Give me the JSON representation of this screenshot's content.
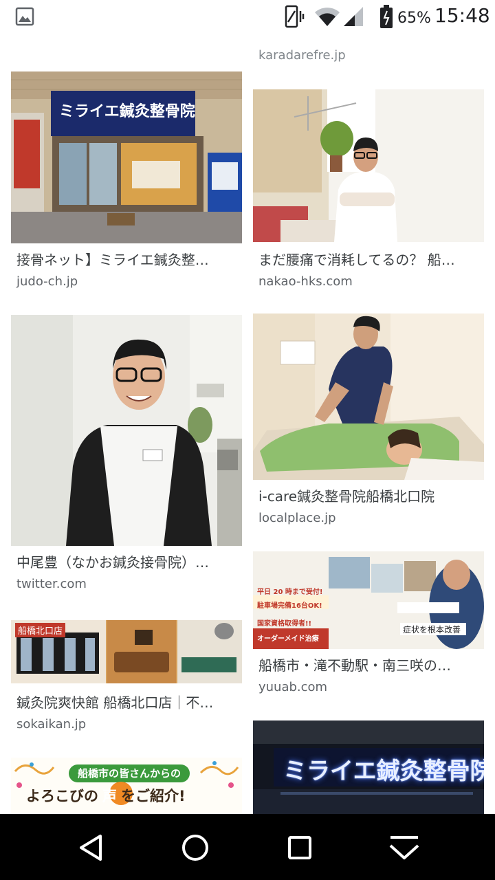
{
  "status_bar": {
    "battery_percent": "65%",
    "time": "15:48",
    "icons": [
      "image-notification-icon",
      "vibrate-icon",
      "wifi-icon",
      "signal-icon",
      "battery-icon"
    ]
  },
  "top_partial": {
    "domain": "karadarefre.jp"
  },
  "results": [
    {
      "title": "接骨ネット】ミライエ鍼灸整…",
      "domain": "judo-ch.jp"
    },
    {
      "title": "まだ腰痛で消耗してるの？ 船…",
      "domain": "nakao-hks.com"
    },
    {
      "title": "中尾豊（なかお鍼灸接骨院）…",
      "domain": "twitter.com"
    },
    {
      "title": "i-care鍼灸整骨院船橋北口院",
      "domain": "localplace.jp"
    },
    {
      "title": "鍼灸院爽快館 船橋北口店｜不…",
      "domain": "sokaikan.jp"
    },
    {
      "title": "船橋市・滝不動駅・南三咲の…",
      "domain": "yuuab.com"
    }
  ],
  "image_text": {
    "storefront_sign": "ミライエ鍼灸整骨院",
    "night_sign": "ミライエ鍼灸整骨院",
    "sokaikan_badge": "船橋北口店",
    "banner_top": "船橋市の皆さんからの",
    "banner_main_a": "よろこびの",
    "banner_main_b": "声",
    "banner_main_c": "をご紹介!",
    "yuuab_line1": "平日 20 時まで受付!",
    "yuuab_line2": "駐車場完備16台OK!",
    "yuuab_line3": "国家資格取得者!!",
    "yuuab_line4": "オーダーメイド治療",
    "yuuab_line5": "症状を根本改善"
  },
  "nav": {
    "buttons": [
      "back-icon",
      "home-icon",
      "recents-icon",
      "keyboard-hide-icon"
    ]
  },
  "colors": {
    "title_text": "#3c4043",
    "domain_text": "#5f6368",
    "nav_bg": "#000000",
    "sign_blue": "#1b2a6b"
  }
}
